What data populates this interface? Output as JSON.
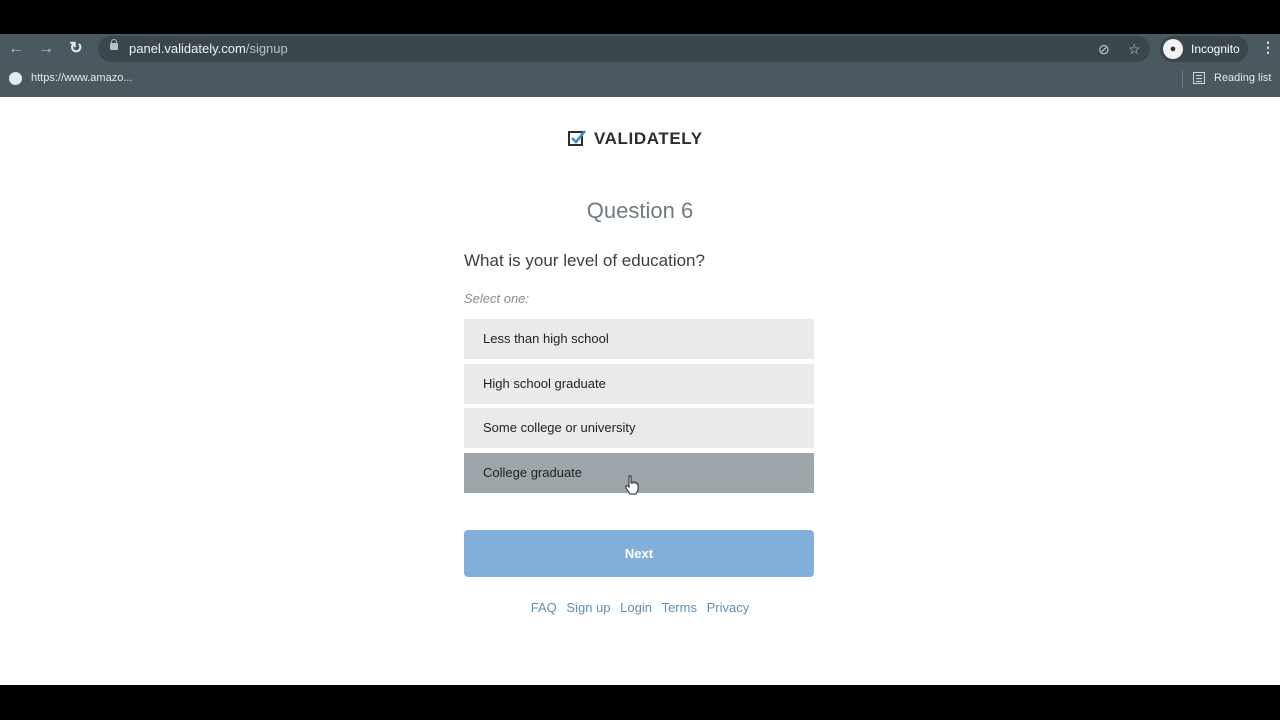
{
  "browser": {
    "url_host": "panel.validately.com",
    "url_path": "/signup",
    "profile_label": "Incognito",
    "bookmark_label": "https://www.amazo...",
    "reading_list_label": "Reading list",
    "icons": [
      "back-icon",
      "forward-icon",
      "reload-icon",
      "lock-icon",
      "eye-off-icon",
      "star-icon",
      "incognito-icon",
      "more-menu-icon",
      "globe-icon",
      "reading-list-icon"
    ]
  },
  "page": {
    "logo_text": "VALIDATELY",
    "question_number": "Question 6",
    "question_text": "What is your level of education?",
    "hint": "Select one:",
    "options": [
      {
        "label": "Less than high school",
        "selected": false
      },
      {
        "label": "High school graduate",
        "selected": false
      },
      {
        "label": "Some college or university",
        "selected": false
      },
      {
        "label": "College graduate",
        "selected": true
      }
    ],
    "next_label": "Next",
    "footer_links": [
      "FAQ",
      "Sign up",
      "Login",
      "Terms",
      "Privacy"
    ]
  },
  "colors": {
    "accent": "#82b0da",
    "link": "#5f8fb8",
    "selected_option": "#9ca6ab",
    "option": "#e9eaeb"
  }
}
